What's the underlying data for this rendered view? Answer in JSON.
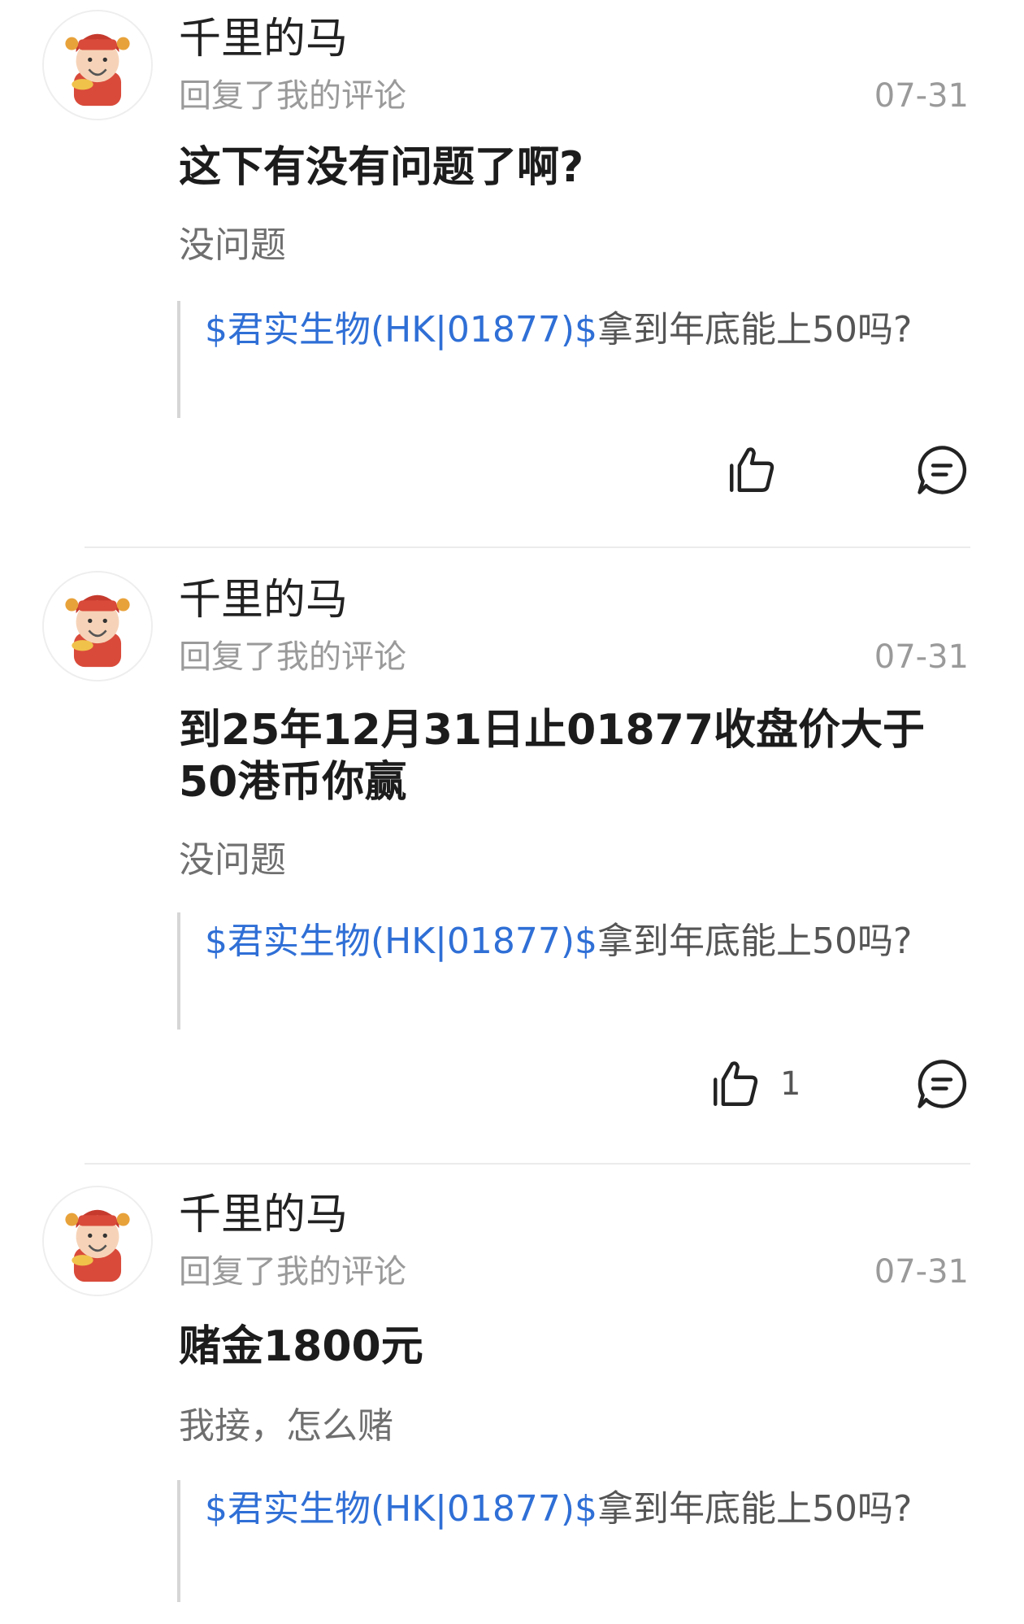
{
  "items": [
    {
      "username": "千里的马",
      "subline": "回复了我的评论",
      "date": "07-31",
      "comment": "这下有没有问题了啊?",
      "reply": "没问题",
      "quote_stock": "$君实生物(HK|01877)$",
      "quote_text": "拿到年底能上50吗?",
      "like_count": ""
    },
    {
      "username": "千里的马",
      "subline": "回复了我的评论",
      "date": "07-31",
      "comment": "到25年12月31日止01877收盘价大于50港币你赢",
      "reply": "没问题",
      "quote_stock": "$君实生物(HK|01877)$",
      "quote_text": "拿到年底能上50吗?",
      "like_count": "1"
    },
    {
      "username": "千里的马",
      "subline": "回复了我的评论",
      "date": "07-31",
      "comment": "赌金1800元",
      "reply": "我接，怎么赌",
      "quote_stock": "$君实生物(HK|01877)$",
      "quote_text": "拿到年底能上50吗?",
      "like_count": ""
    }
  ],
  "icons": {
    "like": "thumbs-up-icon",
    "reply": "comment-bubble-icon",
    "avatar": "god-of-wealth-avatar"
  },
  "colors": {
    "stock_link": "#2f6fd6",
    "muted": "#9a9a9a",
    "divider": "#ebebeb"
  }
}
